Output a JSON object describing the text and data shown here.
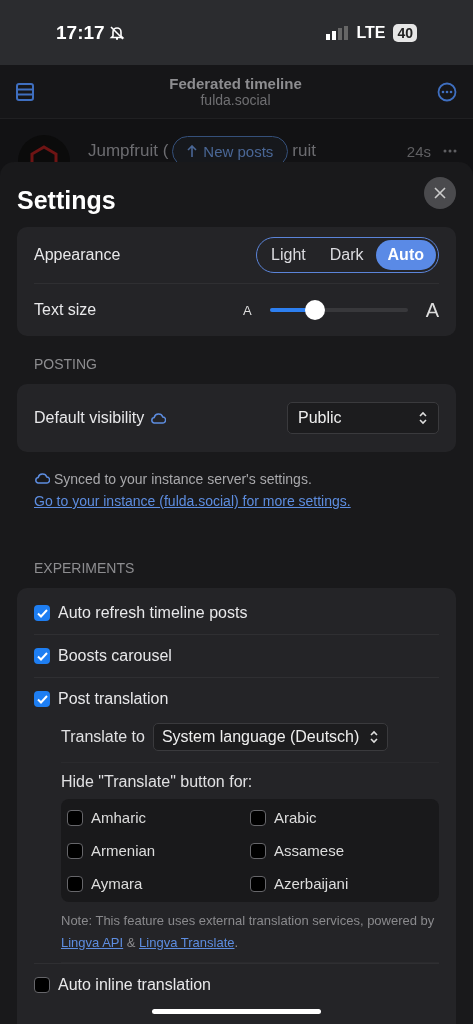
{
  "status_bar": {
    "time": "17:17",
    "network": "LTE",
    "battery": "40"
  },
  "header": {
    "title": "Federated timeline",
    "subtitle": "fulda.social"
  },
  "timeline_peek": {
    "author_parts": [
      "Jumpfruit (",
      "ruit"
    ],
    "time": "24s",
    "new_posts_button": "New posts"
  },
  "settings": {
    "title": "Settings",
    "appearance": {
      "label": "Appearance",
      "options": [
        {
          "label": "Light",
          "selected": false
        },
        {
          "label": "Dark",
          "selected": false
        },
        {
          "label": "Auto",
          "selected": true
        }
      ]
    },
    "text_size": {
      "label": "Text size",
      "small_mark": "A",
      "large_mark": "A",
      "level": 0.33
    },
    "posting": {
      "heading": "POSTING",
      "default_visibility": {
        "label": "Default visibility",
        "value": "Public"
      },
      "note": "Synced to your instance server's settings.",
      "note_link": "Go to your instance (fulda.social) for more settings."
    },
    "experiments": {
      "heading": "EXPERIMENTS",
      "items": [
        {
          "kind": "checkbox",
          "label": "Auto refresh timeline posts",
          "checked": true
        },
        {
          "kind": "checkbox",
          "label": "Boosts carousel",
          "checked": true
        },
        {
          "kind": "translation",
          "label": "Post translation",
          "checked": true,
          "translate_to_label": "Translate to",
          "translate_to_value": "System language (Deutsch)",
          "hide_label": "Hide \"Translate\" button for:",
          "languages": [
            {
              "label": "Amharic",
              "checked": false
            },
            {
              "label": "Arabic",
              "checked": false
            },
            {
              "label": "Armenian",
              "checked": false
            },
            {
              "label": "Assamese",
              "checked": false
            },
            {
              "label": "Aymara",
              "checked": false
            },
            {
              "label": "Azerbaijani",
              "checked": false
            }
          ],
          "note": "Note: This feature uses external translation services, powered by",
          "note_links": [
            "Lingva API",
            "Lingva Translate"
          ],
          "note_joiner": "&",
          "note_end": "."
        },
        {
          "kind": "checkbox",
          "label": "Auto inline translation",
          "checked": false
        }
      ]
    }
  }
}
